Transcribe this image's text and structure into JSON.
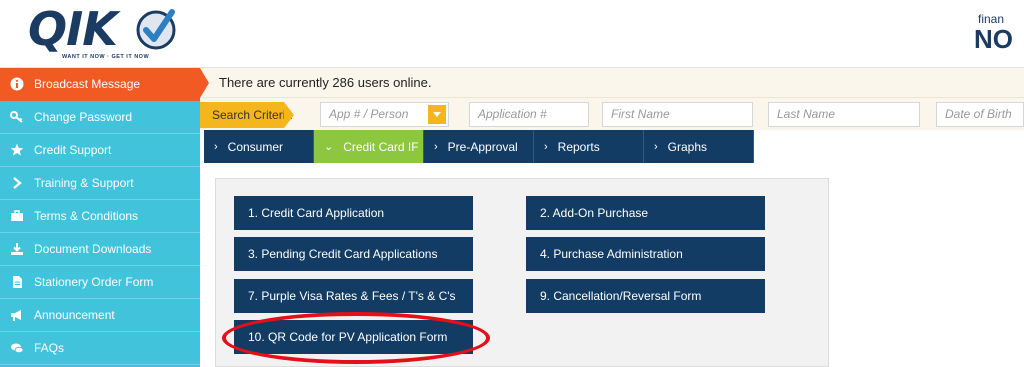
{
  "header": {
    "logo_text": "QIK",
    "logo_tagline": "WANT IT NOW · GET IT NOW",
    "right_brand_small": "finan",
    "right_brand_big": "NO"
  },
  "sidebar": {
    "items": [
      {
        "label": "Broadcast Message",
        "icon": "info-icon",
        "active": true
      },
      {
        "label": "Change Password",
        "icon": "key-icon"
      },
      {
        "label": "Credit Support",
        "icon": "star-icon"
      },
      {
        "label": "Training & Support",
        "icon": "chevron-right-icon"
      },
      {
        "label": "Terms & Conditions",
        "icon": "briefcase-icon"
      },
      {
        "label": "Document Downloads",
        "icon": "download-icon"
      },
      {
        "label": "Stationery Order Form",
        "icon": "document-icon"
      },
      {
        "label": "Announcement",
        "icon": "megaphone-icon"
      },
      {
        "label": "FAQs",
        "icon": "chat-icon"
      }
    ]
  },
  "broadcast": {
    "text": "There are currently 286 users online."
  },
  "search": {
    "label": "Search Criteria",
    "app_person_placeholder": "App # / Person",
    "application_placeholder": "Application #",
    "first_name_placeholder": "First Name",
    "last_name_placeholder": "Last Name",
    "dob_placeholder": "Date of Birth"
  },
  "tabs": [
    {
      "label": "Consumer",
      "active": false
    },
    {
      "label": "Credit Card IF",
      "active": true
    },
    {
      "label": "Pre-Approval",
      "active": false
    },
    {
      "label": "Reports",
      "active": false
    },
    {
      "label": "Graphs",
      "active": false
    }
  ],
  "menu": {
    "items": [
      "1. Credit Card Application",
      "2. Add-On Purchase",
      "3. Pending Credit Card Applications",
      "4. Purchase Administration",
      "7. Purple Visa Rates & Fees / T's & C's",
      "9. Cancellation/Reversal Form",
      "10. QR Code for PV Application Form"
    ]
  },
  "colors": {
    "sidebar": "#41c3dc",
    "active_orange": "#f15a22",
    "navy": "#123c63",
    "green_tab": "#8dc63f",
    "search_yellow": "#f5b51d",
    "highlight_red": "#e3101b"
  }
}
